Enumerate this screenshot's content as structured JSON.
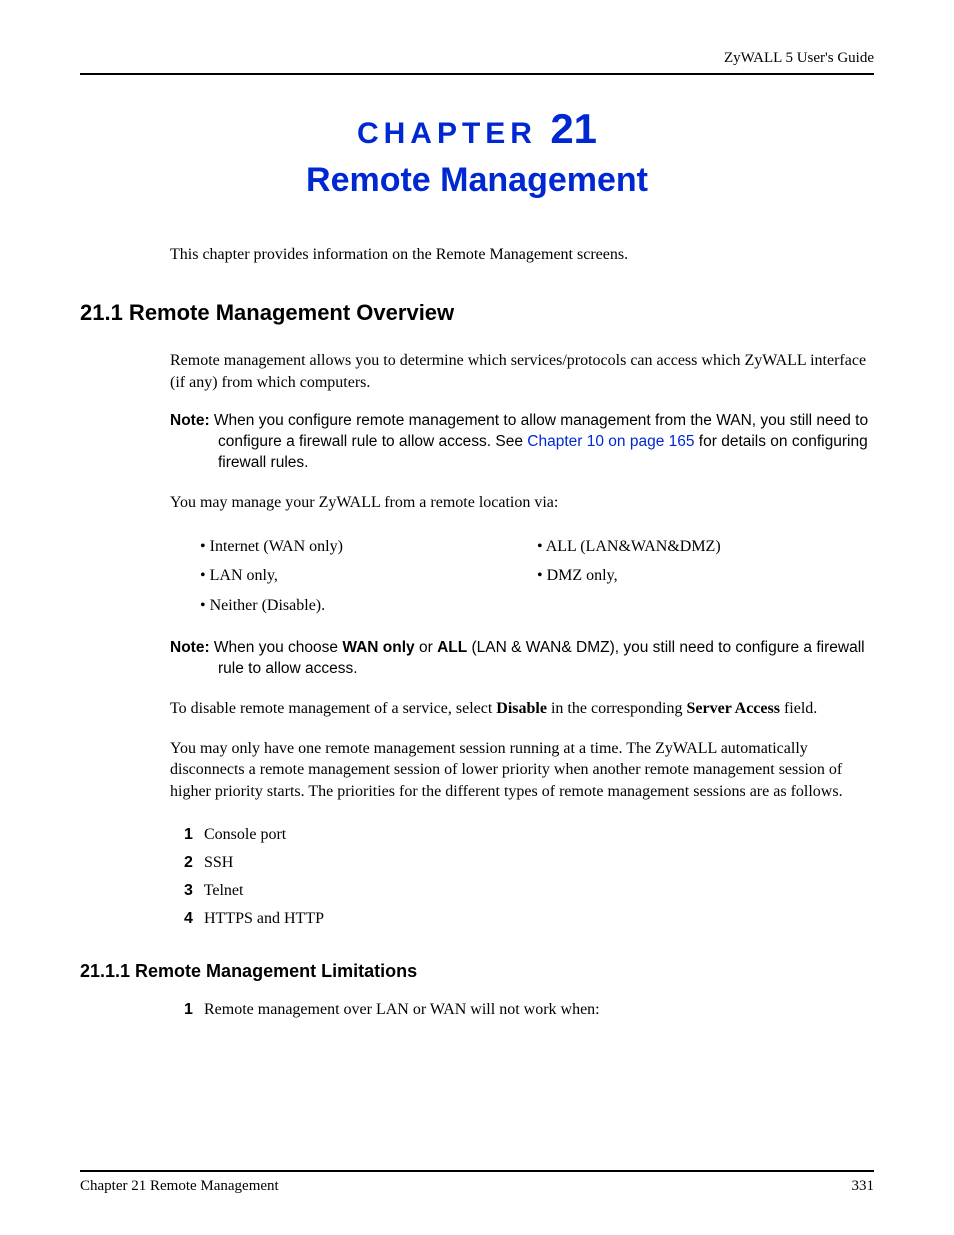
{
  "header": {
    "right": "ZyWALL 5 User's Guide"
  },
  "chapter": {
    "label": "CHAPTER",
    "number": "21",
    "title": "Remote Management"
  },
  "intro": "This chapter provides information on the Remote Management screens.",
  "section1": {
    "heading": "21.1  Remote Management Overview",
    "p1": "Remote management allows you to determine which services/protocols can access which ZyWALL interface (if any) from which computers.",
    "note1": {
      "label": "Note:",
      "text": " When you configure remote management to allow management from the WAN, you still need to configure a firewall rule to allow access. See ",
      "link": "Chapter 10 on page 165",
      "after": " for details on configuring firewall rules."
    },
    "p2": "You may manage your ZyWALL from a remote location via:",
    "bullets_left": [
      "Internet (WAN only)",
      "LAN only,",
      "Neither (Disable)."
    ],
    "bullets_right": [
      "ALL (LAN&WAN&DMZ)",
      "DMZ only,"
    ],
    "note2": {
      "label": "Note:",
      "before": " When you choose ",
      "b1": "WAN only",
      "mid": " or ",
      "b2": "ALL",
      "after": " (LAN & WAN& DMZ), you still need to configure a firewall rule to allow access."
    },
    "p3a": "To disable remote management of a service, select ",
    "p3b": "Disable",
    "p3c": " in the corresponding ",
    "p3d": "Server Access",
    "p3e": " field.",
    "p4": "You may only have one remote management session running at a time. The ZyWALL automatically disconnects a remote management session of lower priority when another remote management session of higher priority starts. The priorities for the different types of remote management sessions are as follows.",
    "priorities": [
      "Console port",
      "SSH",
      "Telnet",
      "HTTPS and HTTP"
    ]
  },
  "section2": {
    "heading": "21.1.1  Remote Management Limitations",
    "item1_num": "1",
    "item1_text": "Remote management over LAN or WAN will not work when:"
  },
  "footer": {
    "left": "Chapter 21 Remote Management",
    "right": "331"
  }
}
